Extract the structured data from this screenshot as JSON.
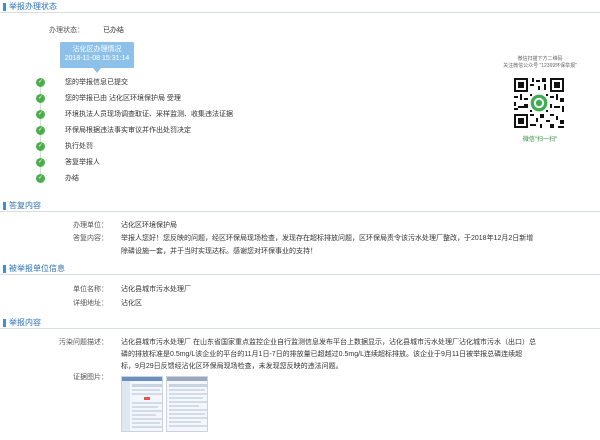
{
  "colors": {
    "accent": "#3a8fd6",
    "success": "#4cae4c",
    "status_box": "#8ec1ea",
    "qr_caption": "#2c8a3a"
  },
  "status_section": {
    "title": "举报办理状态",
    "label": "办理状态：",
    "value": "已办结",
    "box_line1": "沾化区办理情况",
    "box_line2": "2018-11-08 15:31:14",
    "steps": [
      {
        "text": "您的举报信息已提交",
        "icon": "check-icon"
      },
      {
        "text": "您的举报已由 沾化区环境保护局 受理",
        "icon": "check-icon"
      },
      {
        "text": "环境执法人员现场调查取证、采样监测、收集违法证据",
        "icon": "check-icon"
      },
      {
        "text": "环保局根据违法事实审议并作出处罚决定",
        "icon": "check-icon"
      },
      {
        "text": "执行处罚",
        "icon": "check-icon"
      },
      {
        "text": "答复举报人",
        "icon": "check-icon"
      },
      {
        "text": "办结",
        "icon": "check-icon"
      }
    ],
    "qr": {
      "caption1": "微信扫描下方二维码",
      "caption2": "关注微信公众号 \"12369环保举报\"",
      "caption3": "微信\"扫一扫\""
    }
  },
  "reply_section": {
    "title": "答复内容",
    "unit_label": "办理单位：",
    "unit_value": "沾化区环境保护局",
    "content_label": "答复内容：",
    "content_line1": "举报人您好！您反映的问题，经区环保局现场检查，发现存在超标排放问题，区环保局责令该污水处理厂整改，于2018年12月2日新增",
    "content_line2": "除磷设施一套，并于当时实现达标。感谢您对环保事业的支持！"
  },
  "reported_section": {
    "title": "被举报单位信息",
    "name_label": "单位名称：",
    "name_value": "沾化县城市污水处理厂",
    "address_label": "详细地址：",
    "address_value": "沾化区"
  },
  "report_section": {
    "title": "举报内容",
    "desc_label": "污染问题描述：",
    "desc_line1": "沾化县城市污水处理厂 在山东省国家重点监控企业自行监测信息发布平台上数据显示，沾化县城市污水处理厂沾化城市污水（出口）总",
    "desc_line2": "磷的排放标准是0.5mg/L该企业的平台的11月1日-7日的排放量已超越过0.5mg/L连续超标排放。该企业于9月11日被举报总磷连续超",
    "desc_line3": "标，9月29日反馈经沾化区环保局现场检查，未发现您反映的违法问题。",
    "evidence_label": "证据图片："
  }
}
